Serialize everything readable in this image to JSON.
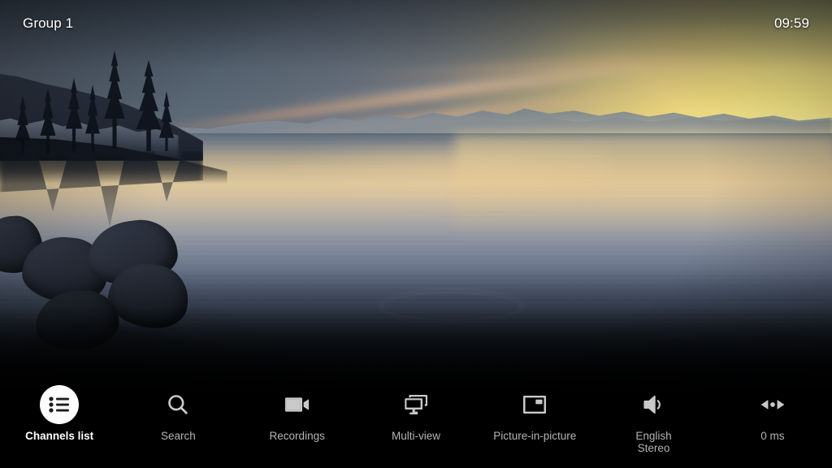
{
  "topbar": {
    "group_label": "Group 1",
    "clock": "09:59"
  },
  "menu": {
    "items": [
      {
        "id": "channels-list",
        "label": "Channels list",
        "icon": "list-icon",
        "selected": true
      },
      {
        "id": "search",
        "label": "Search",
        "icon": "search-icon",
        "selected": false
      },
      {
        "id": "recordings",
        "label": "Recordings",
        "icon": "video-camera-icon",
        "selected": false
      },
      {
        "id": "multi-view",
        "label": "Multi-view",
        "icon": "multi-screen-icon",
        "selected": false
      },
      {
        "id": "picture-in-picture",
        "label": "Picture-in-picture",
        "icon": "pip-icon",
        "selected": false
      },
      {
        "id": "audio-track",
        "label": "English\nStereo",
        "icon": "speaker-icon",
        "selected": false
      },
      {
        "id": "audio-sync",
        "label": "0 ms",
        "icon": "audio-sync-icon",
        "selected": false
      }
    ]
  },
  "video": {
    "scene_description": "Sunset over a calm lake with pine trees and boulders in silhouette"
  },
  "colors": {
    "selected_bg": "#ffffff",
    "selected_icon": "#1c1c1c",
    "selected_label": "#ffffff",
    "idle_icon": "#c9c9c9",
    "idle_label": "#b4b4b4",
    "bar_background": "#000000",
    "topbar_text": "#ffffff"
  }
}
